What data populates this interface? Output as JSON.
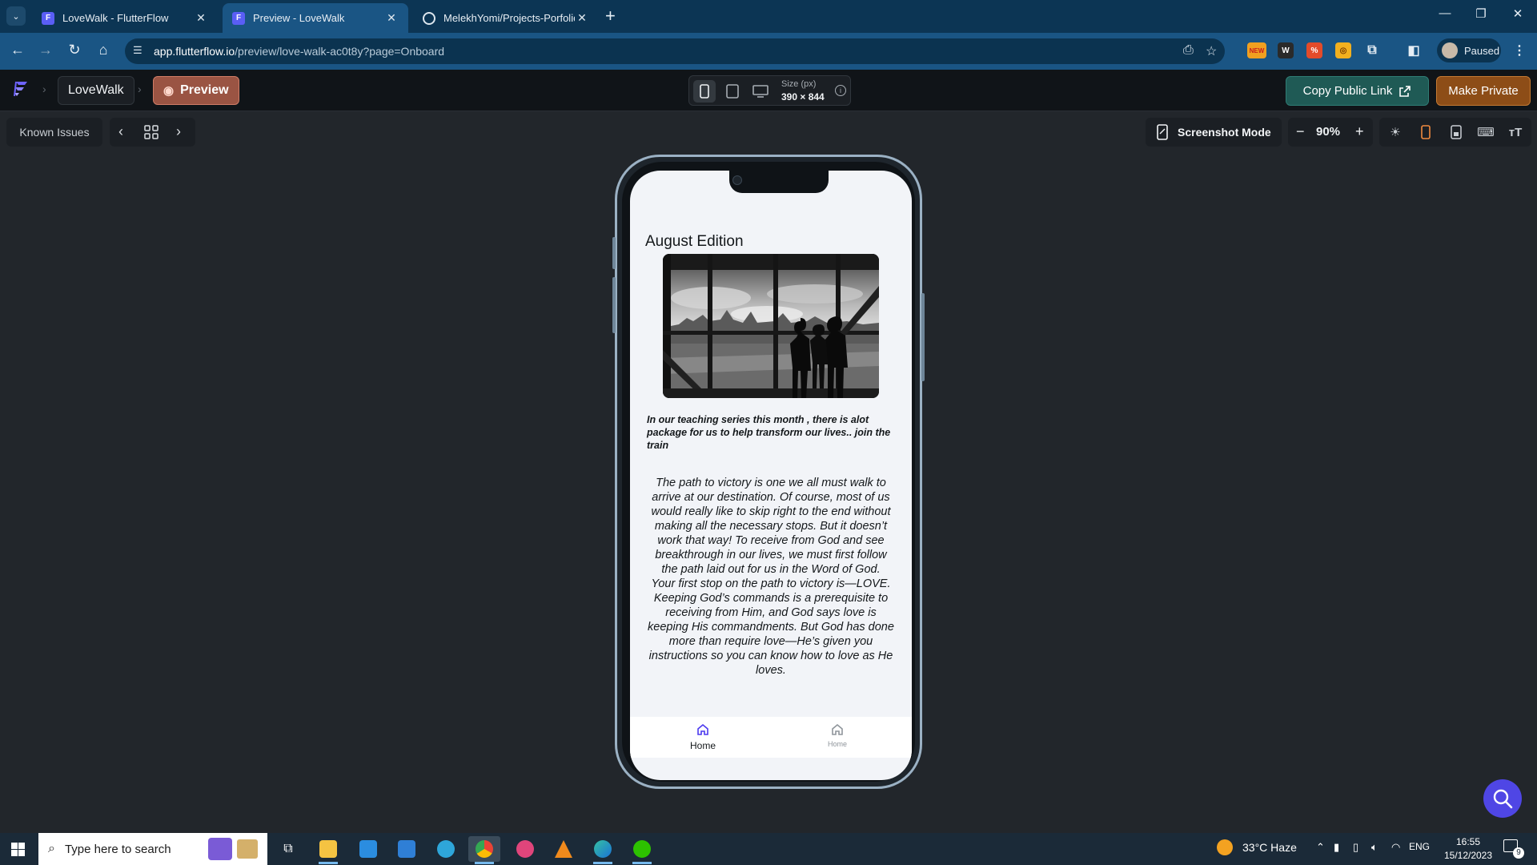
{
  "browser": {
    "tabs": [
      {
        "label": "LoveWalk - FlutterFlow",
        "active": false
      },
      {
        "label": "Preview - LoveWalk",
        "active": true
      },
      {
        "label": "MelekhYomi/Projects-Porfolio-I",
        "active": false
      }
    ],
    "url_host": "app.flutterflow.io",
    "url_path": "/preview/love-walk-ac0t8y?page=Onboard",
    "profile_label": "Paused",
    "extension_badge": "NEW"
  },
  "ff_toolbar": {
    "project_name": "LoveWalk",
    "preview_label": "Preview",
    "size_label": "Size (px)",
    "size_value": "390 × 844",
    "copy_link_label": "Copy Public Link",
    "make_private_label": "Make Private"
  },
  "secondary_toolbar": {
    "known_issues_label": "Known Issues",
    "screenshot_mode_label": "Screenshot Mode",
    "zoom_level": "90%"
  },
  "app": {
    "title": "August Edition",
    "hero_image_alt": "Silhouettes of people at a large window overlooking a city",
    "intro": "In our teaching series this month , there is alot package for us to help transform our lives.. join the train",
    "body": "The path to victory is one we all must walk to arrive at our destination. Of course, most of us would really like to skip right to the end without making all the necessary stops. But it doesn’t work that way! To receive from God and see breakthrough in our lives, we must first follow the path laid out for us in the Word of God.\nYour first stop on the path to victory is—LOVE. Keeping God’s commands is a prerequisite to receiving from Him, and God says love is keeping His commandments. But God has done more than require love—He’s given you instructions so you can know how to love as He loves.",
    "nav": [
      {
        "label": "Home",
        "active": true
      },
      {
        "label": "Home",
        "active": false
      }
    ]
  },
  "taskbar": {
    "search_placeholder": "Type here to search",
    "weather": "33°C  Haze",
    "language": "ENG",
    "time": "16:55",
    "date": "15/12/2023",
    "notification_count": "9"
  },
  "colors": {
    "chrome_tabstrip": "#0c3554",
    "chrome_toolbar": "#1a5584",
    "ff_background": "#22262b",
    "preview_accent": "#9a5443",
    "copy_link_bg": "#1f5a55",
    "make_private_bg": "#8d4d17",
    "app_primary": "#4b39ef",
    "app_background": "#f2f4f8"
  }
}
